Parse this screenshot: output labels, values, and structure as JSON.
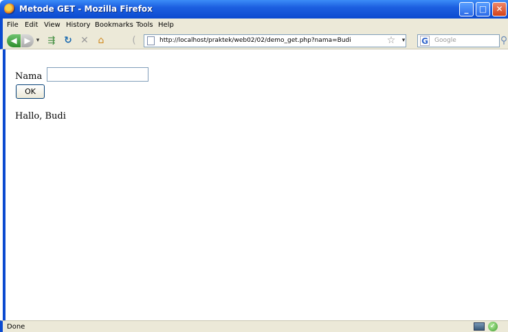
{
  "window": {
    "title": "Metode GET - Mozilla Firefox"
  },
  "menubar": {
    "items": [
      {
        "label": "File"
      },
      {
        "label": "Edit"
      },
      {
        "label": "View"
      },
      {
        "label": "History"
      },
      {
        "label": "Bookmarks"
      },
      {
        "label": "Tools"
      },
      {
        "label": "Help"
      }
    ]
  },
  "toolbar": {
    "url": "http://localhost/praktek/web02/02/demo_get.php?nama=Budi",
    "search_placeholder": "Google"
  },
  "content": {
    "nama_label": "Nama",
    "nama_value": "",
    "ok_label": "OK",
    "greeting": "Hallo, Budi"
  },
  "statusbar": {
    "status": "Done"
  },
  "icons": {
    "app": "firefox-icon",
    "back": "back-arrow-icon",
    "forward": "forward-arrow-icon",
    "reload": "reload-icon",
    "stop": "stop-icon",
    "home": "home-icon",
    "bookmark_star": "star-icon",
    "search": "magnifier-icon"
  }
}
